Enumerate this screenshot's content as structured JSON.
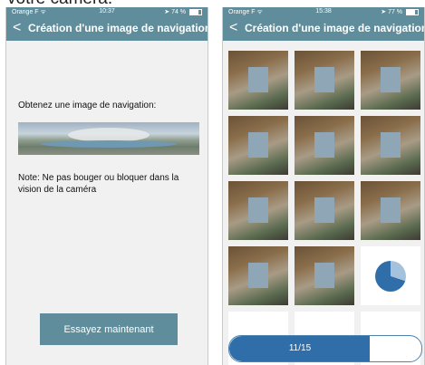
{
  "caption_cut": "votre caméra.",
  "left_screen": {
    "status": {
      "carrier": "Orange F",
      "time": "10:37",
      "battery": "74 %",
      "battery_level": 0.74
    },
    "nav": {
      "back_glyph": "<",
      "title": "Création d'une image de navigation"
    },
    "heading": "Obtenez une image de navigation:",
    "note": "Note: Ne pas bouger ou bloquer dans la vision de la caméra",
    "button": "Essayez maintenant"
  },
  "right_screen": {
    "status": {
      "carrier": "Orange F",
      "time": "15:38",
      "battery": "77 %",
      "battery_level": 0.77
    },
    "nav": {
      "back_glyph": "<",
      "title": "Création d'une image de navigation"
    },
    "captured_count": 11,
    "total_count": 15,
    "progress_label": "11/15",
    "progress_fraction": 0.733,
    "spinner_fraction": 0.3
  }
}
